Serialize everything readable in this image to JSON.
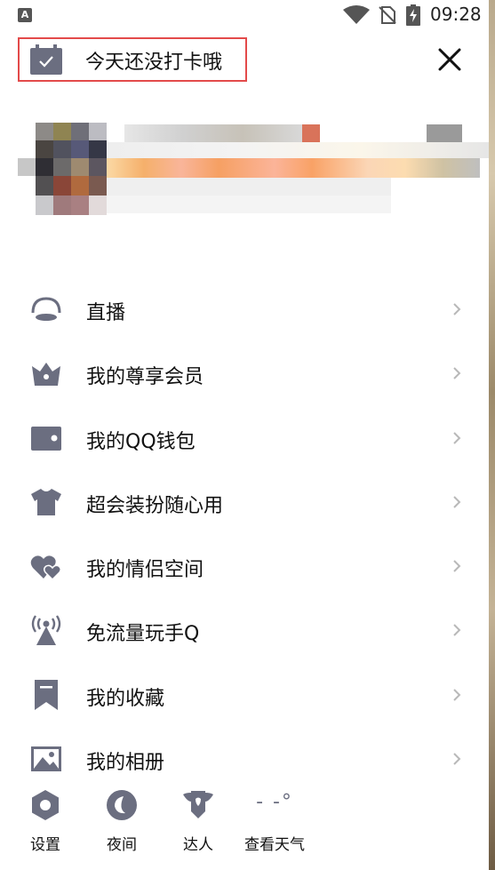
{
  "status_bar": {
    "left_icon_letter": "A",
    "time": "09:28",
    "icons": [
      "wifi-icon",
      "no-sim-icon",
      "battery-charging-icon"
    ]
  },
  "header": {
    "checkin_text": "今天还没打卡哦",
    "checkin_icon": "calendar-check-icon",
    "close_icon": "close-icon"
  },
  "colors": {
    "icon_gray": "#6b6e80",
    "chevron": "#b8b8b8",
    "highlight_border": "#e34a4a"
  },
  "menu": {
    "items": [
      {
        "label": "直播",
        "icon": "live-broadcast-icon"
      },
      {
        "label": "我的尊享会员",
        "icon": "vip-crown-icon"
      },
      {
        "label": "我的QQ钱包",
        "icon": "wallet-icon"
      },
      {
        "label": "超会装扮随心用",
        "icon": "tshirt-icon"
      },
      {
        "label": "我的情侣空间",
        "icon": "hearts-icon"
      },
      {
        "label": "免流量玩手Q",
        "icon": "signal-tower-icon"
      },
      {
        "label": "我的收藏",
        "icon": "bookmark-icon"
      },
      {
        "label": "我的相册",
        "icon": "photo-album-icon"
      }
    ]
  },
  "bottom_bar": {
    "items": [
      {
        "label": "设置",
        "icon": "settings-icon"
      },
      {
        "label": "夜间",
        "icon": "night-mode-icon"
      },
      {
        "label": "达人",
        "icon": "expert-badge-icon"
      },
      {
        "label": "查看天气",
        "icon": "weather-icon",
        "icon_text": "- -°"
      }
    ]
  }
}
